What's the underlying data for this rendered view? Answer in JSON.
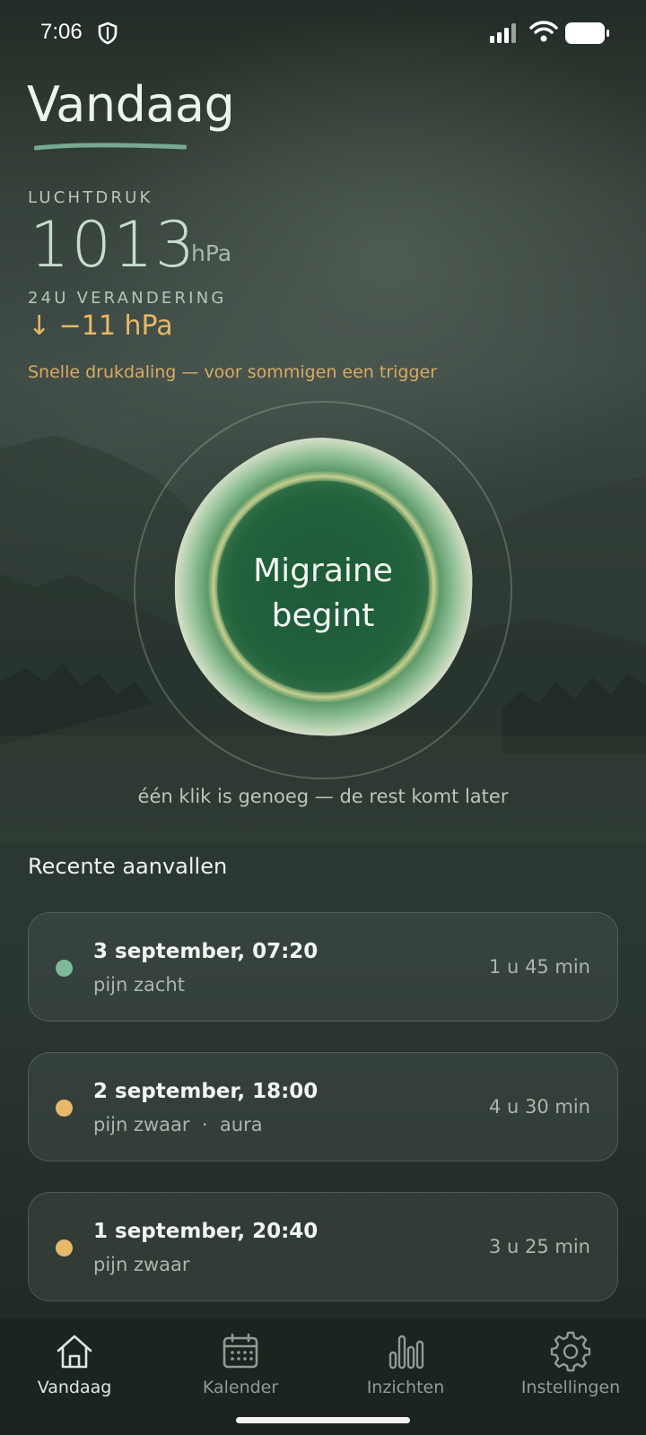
{
  "status_bar": {
    "time": "7:06"
  },
  "header": {
    "title": "Vandaag"
  },
  "pressure": {
    "label": "LUCHTDRUK",
    "value": "1013",
    "unit": "hPa",
    "change_label": "24U VERANDERING",
    "change_value": "↓ −11 hPa",
    "change_note": "Snelle drukdaling — voor sommigen een trigger"
  },
  "main_button": {
    "label_line1": "Migraine",
    "label_line2": "begint",
    "hint": "één klik is genoeg — de rest komt later"
  },
  "recent": {
    "title": "Recente aanvallen",
    "items": [
      {
        "date": "3 september, 07:20",
        "detail": "pijn zacht",
        "duration": "1 u 45 min",
        "dot_color": "#7fb89a"
      },
      {
        "date": "2 september, 18:00",
        "detail": "pijn zwaar  ·  aura",
        "duration": "4 u 30 min",
        "dot_color": "#e9b96b"
      },
      {
        "date": "1 september, 20:40",
        "detail": "pijn zwaar",
        "duration": "3 u 25 min",
        "dot_color": "#e9b96b"
      }
    ]
  },
  "tab_bar": {
    "tabs": [
      {
        "label": "Vandaag",
        "icon": "home-icon",
        "active": true
      },
      {
        "label": "Kalender",
        "icon": "calendar-icon",
        "active": false
      },
      {
        "label": "Inzichten",
        "icon": "bar-chart-icon",
        "active": false
      },
      {
        "label": "Instellingen",
        "icon": "gear-icon",
        "active": false
      }
    ]
  },
  "colors": {
    "accent_warning": "#e7b868",
    "accent_green": "#7fb89a",
    "background": "#2f3b35"
  }
}
